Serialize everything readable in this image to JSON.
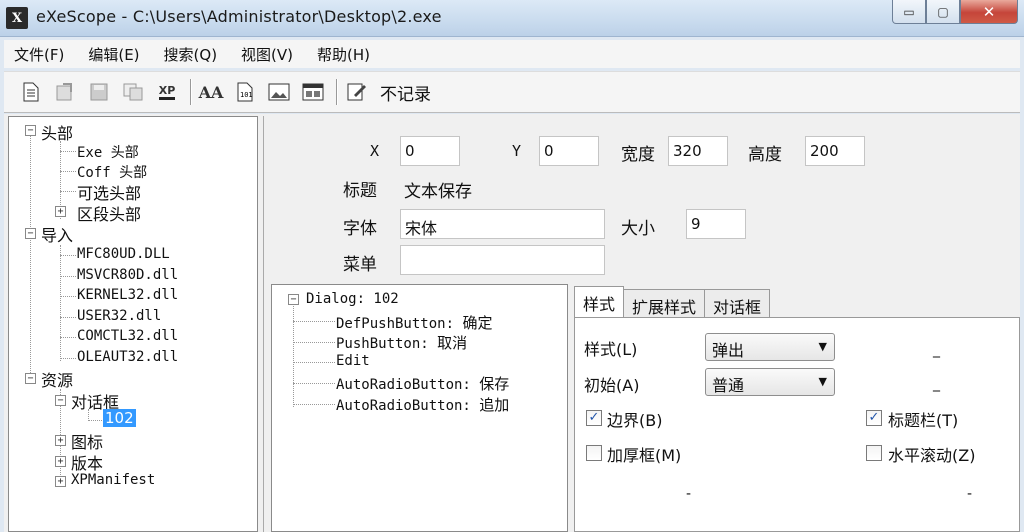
{
  "window": {
    "title": "eXeScope - C:\\Users\\Administrator\\Desktop\\2.exe",
    "icon_letter": "X",
    "minimize": "▭",
    "maximize": "▢",
    "close": "✕"
  },
  "menu": [
    "文件(F)",
    "编辑(E)",
    "搜索(Q)",
    "视图(V)",
    "帮助(H)"
  ],
  "toolbar": {
    "buttons": [
      "new-doc-icon",
      "export-icon",
      "save-icon",
      "copy-icon",
      "xp-icon",
      "font-icon",
      "hex-icon",
      "image-icon",
      "dialog-icon",
      "record-icon"
    ],
    "xp_text": "XP",
    "font_text": "AA",
    "record_label": "不记录"
  },
  "tree": {
    "header": "头部",
    "exe_header": "Exe 头部",
    "coff_header": "Coff 头部",
    "optional_header": "可选头部",
    "section_header": "区段头部",
    "imports": "导入",
    "dlls": [
      "MFC80UD.DLL",
      "MSVCR80D.dll",
      "KERNEL32.dll",
      "USER32.dll",
      "COMCTL32.dll",
      "OLEAUT32.dll"
    ],
    "resources": "资源",
    "dialog": "对话框",
    "dialog_id": "102",
    "icon": "图标",
    "version": "版本",
    "manifest": "XPManifest"
  },
  "props": {
    "x_label": "X",
    "x_value": "0",
    "y_label": "Y",
    "y_value": "0",
    "width_label": "宽度",
    "width_value": "320",
    "height_label": "高度",
    "height_value": "200",
    "title_label": "标题",
    "title_value": "文本保存",
    "font_label": "字体",
    "font_value": "宋体",
    "size_label": "大小",
    "size_value": "9",
    "menu_label": "菜单",
    "menu_value": ""
  },
  "dialog_tree": {
    "root": "Dialog: 102",
    "items": [
      {
        "type": "DefPushButton:",
        "text": "确定"
      },
      {
        "type": "PushButton:",
        "text": "取消"
      },
      {
        "type": "Edit",
        "text": ""
      },
      {
        "type": "AutoRadioButton:",
        "text": "保存"
      },
      {
        "type": "AutoRadioButton:",
        "text": "追加"
      }
    ]
  },
  "tabs": [
    "样式",
    "扩展样式",
    "对话框"
  ],
  "style_panel": {
    "style_label": "样式(L)",
    "style_value": "弹出",
    "init_label": "初始(A)",
    "init_value": "普通",
    "border_label": "边界(B)",
    "border_checked": true,
    "titlebar_label": "标题栏(T)",
    "titlebar_checked": true,
    "thick_label": "加厚框(M)",
    "thick_checked": false,
    "hscroll_label": "水平滚动(Z)",
    "hscroll_checked": false,
    "dash": "_",
    "dash2": "-"
  }
}
